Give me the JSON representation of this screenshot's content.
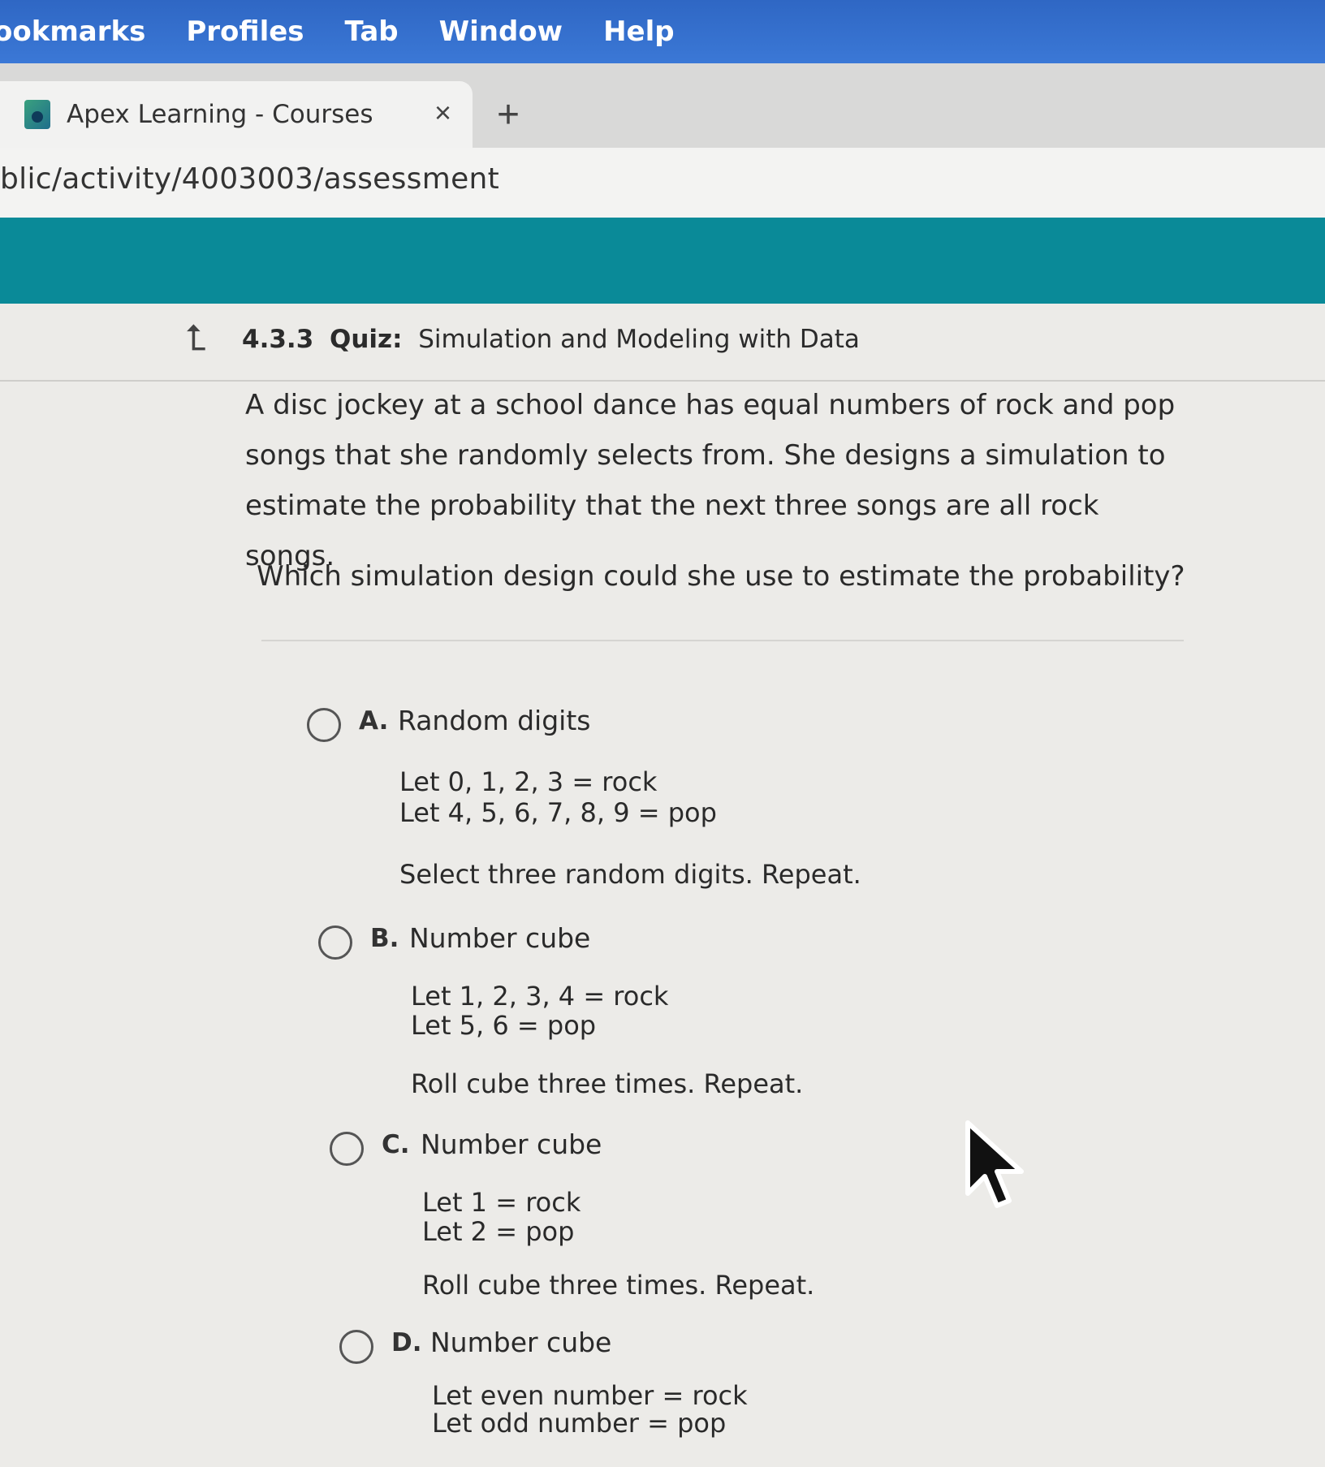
{
  "menubar": {
    "items": [
      "ookmarks",
      "Profiles",
      "Tab",
      "Window",
      "Help"
    ]
  },
  "tab": {
    "title": "Apex Learning - Courses",
    "close_label": "×",
    "new_tab_label": "+"
  },
  "address": {
    "url": "blic/activity/4003003/assessment"
  },
  "quiz": {
    "number": "4.3.3",
    "type": "Quiz:",
    "title": "Simulation and Modeling with Data"
  },
  "question": {
    "text": "A disc jockey at a school dance has equal numbers of rock and pop songs that she randomly selects from. She designs a simulation to estimate the probability that the next three songs are all rock songs.",
    "prompt": "Which simulation design could she use to estimate the probability?"
  },
  "choices": [
    {
      "letter": "A.",
      "heading": "Random digits",
      "lines": [
        "Let 0, 1, 2, 3 = rock",
        "Let 4, 5, 6, 7, 8, 9 = pop"
      ],
      "instruction": "Select three random digits. Repeat."
    },
    {
      "letter": "B.",
      "heading": "Number cube",
      "lines": [
        "Let 1, 2, 3, 4 = rock",
        "Let 5, 6 = pop"
      ],
      "instruction": "Roll cube three times. Repeat."
    },
    {
      "letter": "C.",
      "heading": "Number cube",
      "lines": [
        "Let 1 = rock",
        "Let 2 = pop"
      ],
      "instruction": "Roll cube three times. Repeat."
    },
    {
      "letter": "D.",
      "heading": "Number cube",
      "lines": [
        "Let even number = rock",
        "Let odd number = pop"
      ]
    }
  ],
  "colors": {
    "menubar": "#3b78d6",
    "site_header": "#0a8a98",
    "page_bg": "#ecebe8"
  }
}
